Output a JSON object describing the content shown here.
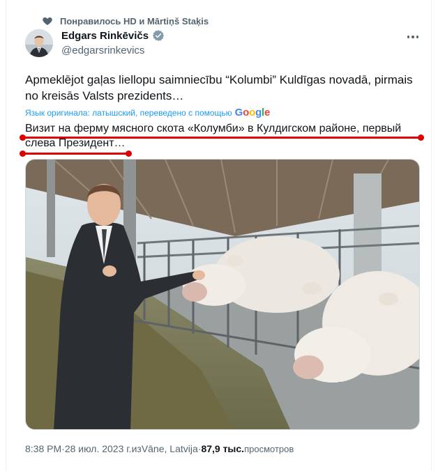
{
  "social_context": {
    "icon": "heart-icon",
    "text": "Понравилось HD и Mārtiņš Staķis"
  },
  "author": {
    "display_name": "Edgars Rinkēvičs",
    "handle": "@edgarsrinkevics",
    "verified": true,
    "verified_color": "#829aab"
  },
  "tweet": {
    "text": "Apmeklējot gaļas liellopu saimniecību “Kolumbi” Kuldīgas novadā, pirmais no kreisās Valsts prezidents…",
    "translation_note": "Язык оригинала: латышский, переведено с помощью",
    "translation_provider": "Google",
    "translated_text": "Визит на ферму мясного скота «Колумби» в Кулдигском районе, первый слева Президент…"
  },
  "meta": {
    "time": "8:38 PM",
    "sep1": " · ",
    "date": "28 июл. 2023 г.",
    "source_prefix": " из ",
    "location": "Vāne, Latvija",
    "sep2": " · ",
    "views_count": "87,9 тыс.",
    "views_label": " просмотров"
  },
  "colors": {
    "accent": "#1d9bf0",
    "secondary_text": "#536471",
    "primary_text": "#0f1419",
    "annotation_red": "#e00000"
  }
}
